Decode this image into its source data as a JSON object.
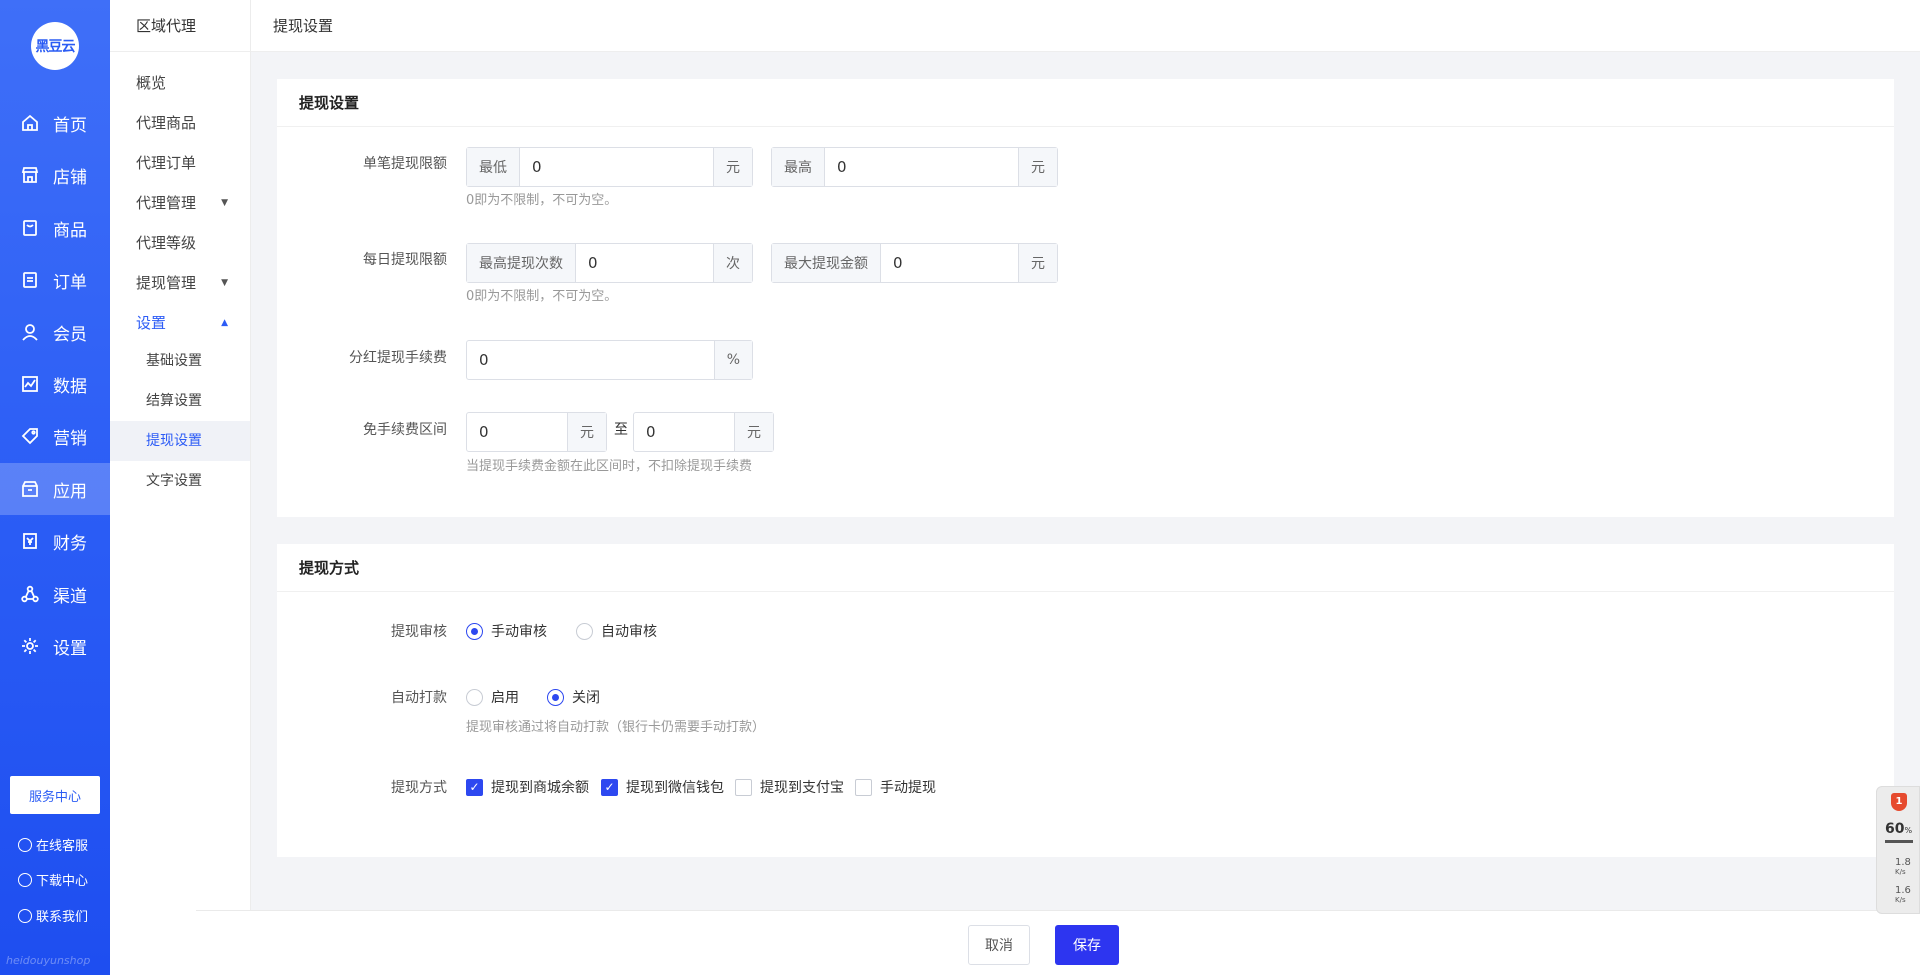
{
  "brand": {
    "logo_text": "黑豆云",
    "watermark": "heidouyunshop"
  },
  "nav": {
    "items": [
      {
        "label": "首页",
        "icon": "home-icon"
      },
      {
        "label": "店铺",
        "icon": "store-icon"
      },
      {
        "label": "商品",
        "icon": "goods-icon"
      },
      {
        "label": "订单",
        "icon": "order-icon"
      },
      {
        "label": "会员",
        "icon": "user-icon"
      },
      {
        "label": "数据",
        "icon": "chart-icon"
      },
      {
        "label": "营销",
        "icon": "tag-icon"
      },
      {
        "label": "应用",
        "icon": "app-icon"
      },
      {
        "label": "财务",
        "icon": "finance-icon"
      },
      {
        "label": "渠道",
        "icon": "channel-icon"
      },
      {
        "label": "设置",
        "icon": "gear-icon"
      }
    ],
    "service_button": "服务中心",
    "links": [
      "在线客服",
      "下载中心",
      "联系我们"
    ]
  },
  "subnav": {
    "title": "区域代理",
    "items": [
      "概览",
      "代理商品",
      "代理订单",
      "代理管理",
      "代理等级",
      "提现管理",
      "设置"
    ],
    "children": [
      "基础设置",
      "结算设置",
      "提现设置",
      "文字设置"
    ]
  },
  "breadcrumb": "提现设置",
  "withdraw_settings": {
    "title": "提现设置",
    "single_limit": {
      "label": "单笔提现限额",
      "min_prefix": "最低",
      "min_value": "0",
      "min_unit": "元",
      "max_prefix": "最高",
      "max_value": "0",
      "max_unit": "元",
      "hint": "0即为不限制，不可为空。"
    },
    "daily_limit": {
      "label": "每日提现限额",
      "count_prefix": "最高提现次数",
      "count_value": "0",
      "count_unit": "次",
      "amount_prefix": "最大提现金额",
      "amount_value": "0",
      "amount_unit": "元",
      "hint": "0即为不限制，不可为空。"
    },
    "fee": {
      "label": "分红提现手续费",
      "value": "0",
      "unit": "%"
    },
    "free_range": {
      "label": "免手续费区间",
      "from_value": "0",
      "from_unit": "元",
      "separator": "至",
      "to_value": "0",
      "to_unit": "元",
      "hint": "当提现手续费金额在此区间时，不扣除提现手续费"
    }
  },
  "withdraw_methods": {
    "title": "提现方式",
    "audit": {
      "label": "提现审核",
      "options": [
        "手动审核",
        "自动审核"
      ],
      "selected": 0
    },
    "auto_pay": {
      "label": "自动打款",
      "options": [
        "启用",
        "关闭"
      ],
      "selected": 1,
      "hint": "提现审核通过将自动打款（银行卡仍需要手动打款）"
    },
    "methods": {
      "label": "提现方式",
      "options": [
        {
          "label": "提现到商城余额",
          "checked": true
        },
        {
          "label": "提现到微信钱包",
          "checked": true
        },
        {
          "label": "提现到支付宝",
          "checked": false
        },
        {
          "label": "手动提现",
          "checked": false
        }
      ]
    }
  },
  "footer": {
    "cancel": "取消",
    "save": "保存"
  },
  "widget": {
    "badge": "1",
    "percent": "60",
    "percent_unit": "%",
    "up": "1.8",
    "down": "1.6",
    "speed_unit": "K/s"
  },
  "colors": {
    "primary": "#2d48f0",
    "nav_bg": "#2a5cf5"
  }
}
